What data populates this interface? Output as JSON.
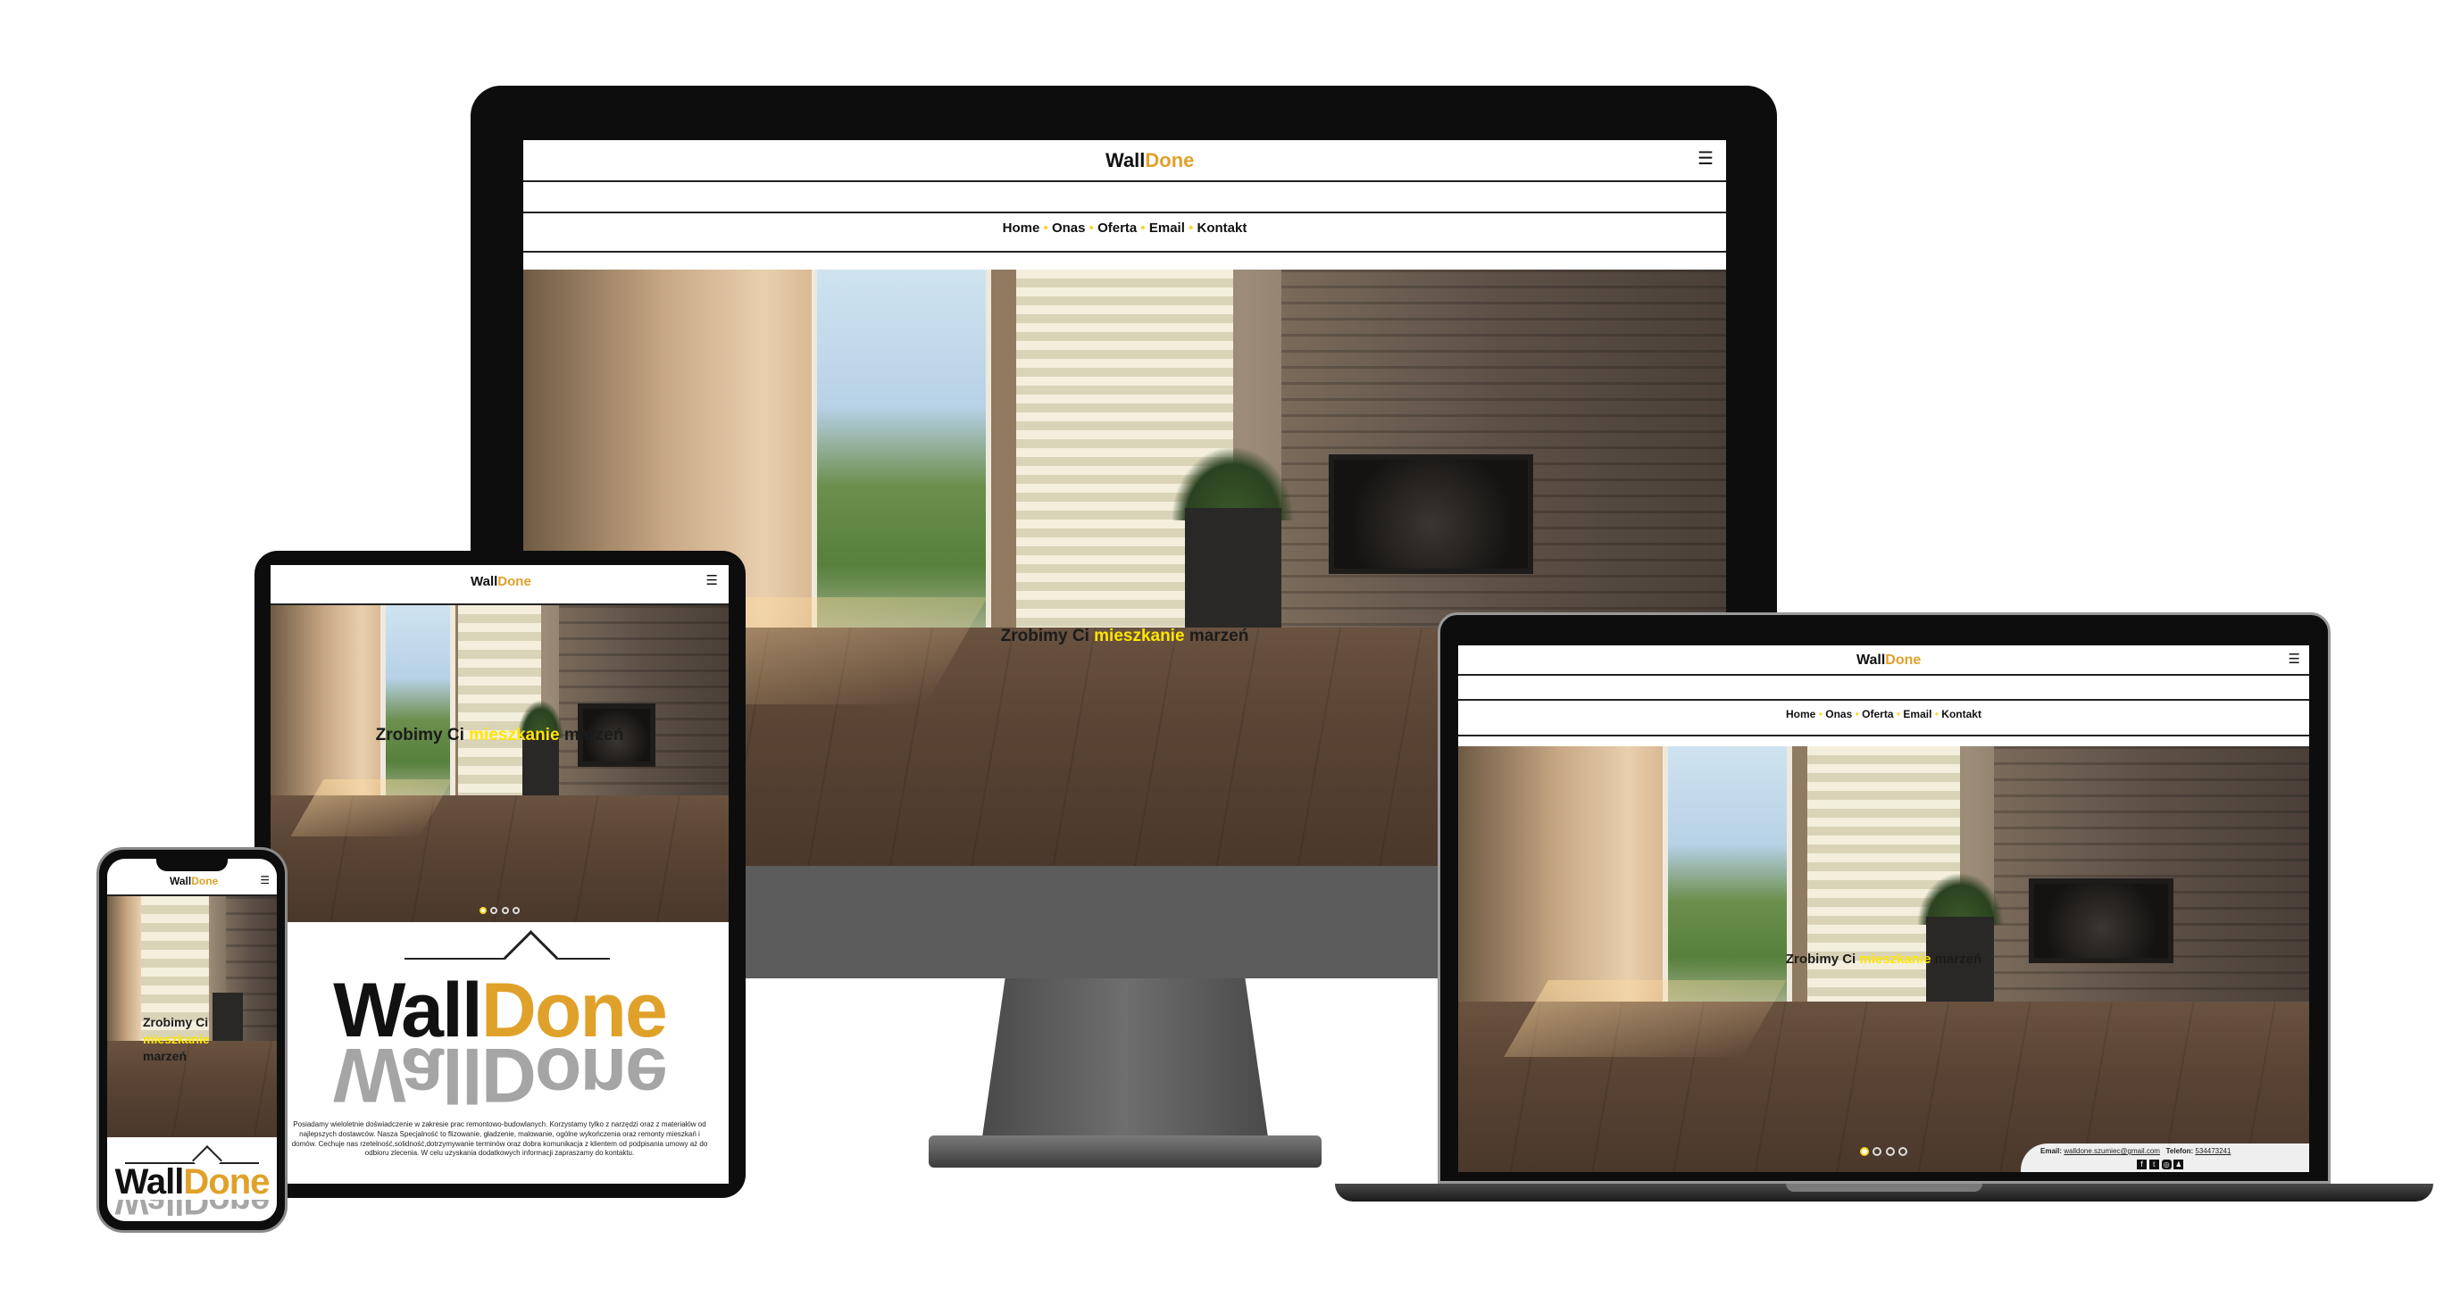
{
  "brand": {
    "wall": "Wall",
    "done": "Done",
    "color_dark": "#111111",
    "color_accent": "#e0a12a"
  },
  "menu_icon": "☰",
  "nav": {
    "items": [
      "Home",
      "Onas",
      "Oferta",
      "Email",
      "Kontakt"
    ],
    "separator": "•",
    "separator_color": "#ffd21f"
  },
  "hero": {
    "before": "Zrobimy Ci",
    "highlight": "mieszkanie",
    "after": "marzeń",
    "highlight_color": "#ffe600"
  },
  "slider": {
    "total": 4,
    "active": 1
  },
  "about": {
    "text": "Posiadamy wieloletnie doświadczenie w zakresie prac remontowo-budowlanych. Korzystamy tylko z narzędzi oraz z materiałów od najlepszych dostawców. Nasza Specjalność to flizowanie, gładzenie, malowanie, ogólne wykończenia oraz remonty mieszkań i domów. Cechuje nas rzetelność,solidność,dotrzymywanie terminów oraz dobra komunikacja z klientem od podpisania umowy aż do odbioru zlecenia. W celu uzyskania dodatkowych informacji zapraszamy do kontaktu."
  },
  "footer": {
    "email_label": "Email:",
    "email": "walldone.szumiec@gmail.com",
    "phone_label": "Telefon:",
    "phone": "534473241",
    "social_icons": [
      "facebook-icon",
      "twitter-icon",
      "instagram-icon",
      "snapchat-icon"
    ]
  }
}
